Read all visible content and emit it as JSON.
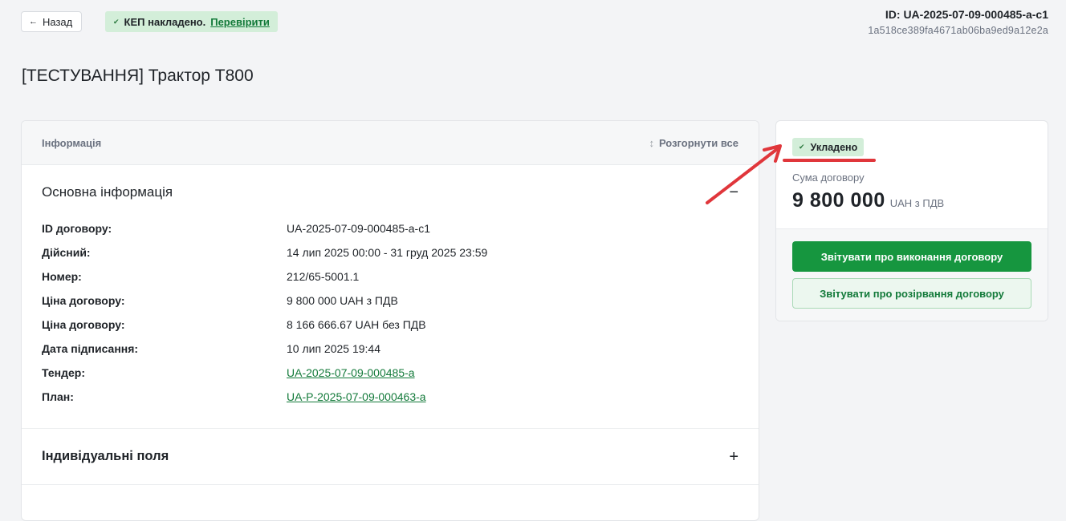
{
  "header": {
    "back_label": "Назад",
    "signature_text": "КЕП накладено.",
    "signature_link": "Перевірити",
    "doc_id": "ID: UA-2025-07-09-000485-a-c1",
    "doc_hash": "1a518ce389fa4671ab06ba9ed9a12e2a"
  },
  "page_title": "[ТЕСТУВАННЯ] Трактор Т800",
  "info": {
    "header_label": "Інформація",
    "expand_all": "Розгорнути все",
    "basic": {
      "title": "Основна інформація",
      "toggle": "−",
      "rows": [
        {
          "label": "ID договору:",
          "value": "UA-2025-07-09-000485-a-c1"
        },
        {
          "label": "Дійсний:",
          "value": "14 лип 2025 00:00 - 31 груд 2025 23:59"
        },
        {
          "label": "Номер:",
          "value": "212/65-5001.1"
        },
        {
          "label": "Ціна договору:",
          "value": "9 800 000 UAH з ПДВ"
        },
        {
          "label": "Ціна договору:",
          "value": "8 166 666.67 UAH без ПДВ"
        },
        {
          "label": "Дата підписання:",
          "value": "10 лип 2025 19:44"
        },
        {
          "label": "Тендер:",
          "value": "UA-2025-07-09-000485-a"
        },
        {
          "label": "План:",
          "value": "UA-P-2025-07-09-000463-a"
        }
      ]
    },
    "custom": {
      "title": "Індивідуальні поля",
      "toggle": "+"
    }
  },
  "side": {
    "status": "Укладено",
    "sum_label": "Сума договору",
    "sum_value": "9 800 000",
    "sum_currency": "UAH з ПДВ",
    "btn_report_execution": "Звітувати про виконання договору",
    "btn_report_termination": "Звітувати про розірвання договору"
  },
  "colors": {
    "accent_green": "#16963f",
    "badge_green_bg": "#d3eed9",
    "annotation_red": "#e0363b"
  },
  "icons": {
    "back": "arrow-left-icon",
    "check": "check-icon",
    "expand": "expand-vertical-icon",
    "collapse": "minus-icon",
    "expand_section": "plus-icon"
  }
}
